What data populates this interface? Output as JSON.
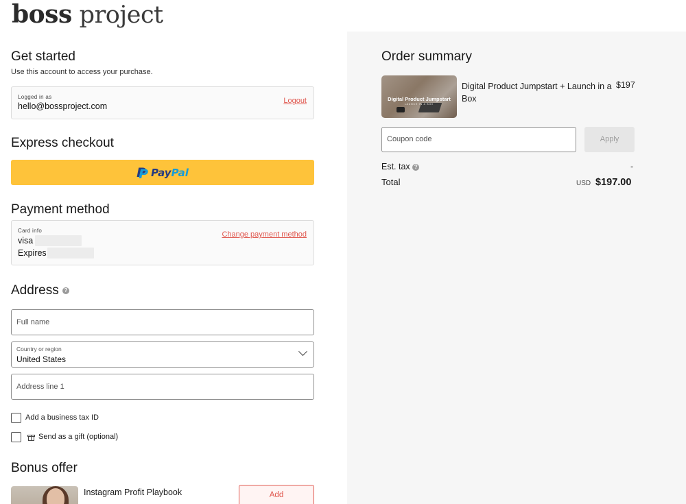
{
  "brand": {
    "logo_bold": "boss",
    "logo_light": "project"
  },
  "get_started": {
    "heading": "Get started",
    "subtitle": "Use this account to access your purchase.",
    "logged_in_label": "Logged in as",
    "email": "hello@bossproject.com",
    "logout_label": "Logout"
  },
  "express": {
    "heading": "Express checkout",
    "paypal_pay": "Pay",
    "paypal_pal": "Pal"
  },
  "payment": {
    "heading": "Payment method",
    "card_info_label": "Card info",
    "card_brand": "visa",
    "expires_label": "Expires",
    "change_label": "Change payment method"
  },
  "address": {
    "heading": "Address",
    "help_icon": "question-circle-icon",
    "full_name_placeholder": "Full name",
    "country_label": "Country or region",
    "country_value": "United States",
    "address_line1_placeholder": "Address line 1"
  },
  "options": {
    "business_tax_label": "Add a business tax ID",
    "gift_label": "Send as a gift (optional)",
    "gift_icon": "gift-icon"
  },
  "bonus": {
    "heading": "Bonus offer",
    "product_title": "Instagram Profit Playbook",
    "add_label": "Add"
  },
  "order_summary": {
    "heading": "Order summary",
    "product_name": "Digital Product Jumpstart + Launch in a Box",
    "product_price": "$197",
    "image_title": "Digital Product Jumpstart",
    "image_subtitle": "LAUNCH IN A BOX",
    "coupon_placeholder": "Coupon code",
    "apply_label": "Apply",
    "tax_label": "Est. tax",
    "tax_value": "-",
    "total_label": "Total",
    "currency": "USD",
    "total_value": "$197.00"
  },
  "colors": {
    "accent": "#e0584f",
    "paypal_yellow": "#fec33a",
    "summary_bg": "#f6f6f6"
  }
}
